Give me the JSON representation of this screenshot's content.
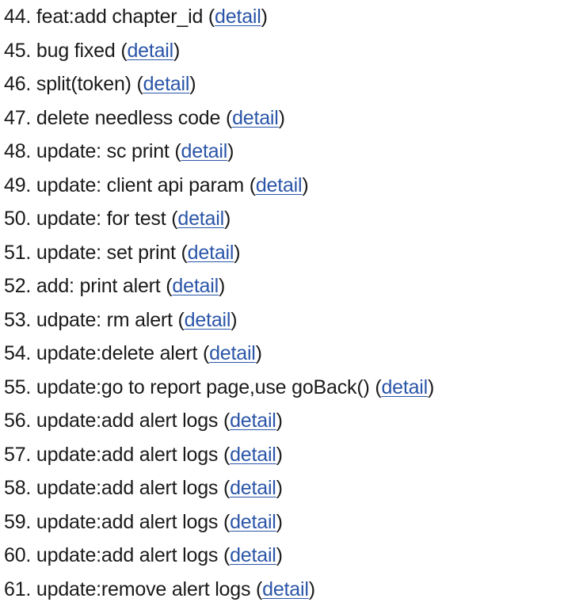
{
  "changes": [
    {
      "number": "44.",
      "message": "feat:add chapter_id",
      "link": "detail"
    },
    {
      "number": "45.",
      "message": "bug fixed",
      "link": "detail"
    },
    {
      "number": "46.",
      "message": "split(token)",
      "link": "detail"
    },
    {
      "number": "47.",
      "message": "delete needless code",
      "link": "detail"
    },
    {
      "number": "48.",
      "message": "update: sc print",
      "link": "detail"
    },
    {
      "number": "49.",
      "message": "update: client api param",
      "link": "detail"
    },
    {
      "number": "50.",
      "message": "update: for test",
      "link": "detail"
    },
    {
      "number": "51.",
      "message": "update: set print",
      "link": "detail"
    },
    {
      "number": "52.",
      "message": "add: print alert",
      "link": "detail"
    },
    {
      "number": "53.",
      "message": "udpate: rm alert",
      "link": "detail"
    },
    {
      "number": "54.",
      "message": "update:delete alert",
      "link": "detail"
    },
    {
      "number": "55.",
      "message": "update:go to report page,use goBack()",
      "link": "detail"
    },
    {
      "number": "56.",
      "message": "update:add alert logs",
      "link": "detail"
    },
    {
      "number": "57.",
      "message": "update:add alert logs",
      "link": "detail"
    },
    {
      "number": "58.",
      "message": "update:add alert logs",
      "link": "detail"
    },
    {
      "number": "59.",
      "message": "update:add alert logs",
      "link": "detail"
    },
    {
      "number": "60.",
      "message": "update:add alert logs",
      "link": "detail"
    },
    {
      "number": "61.",
      "message": "update:remove alert logs",
      "link": "detail"
    }
  ],
  "colors": {
    "text": "#1a1a1a",
    "link": "#2a55a8",
    "background": "#ffffff"
  }
}
